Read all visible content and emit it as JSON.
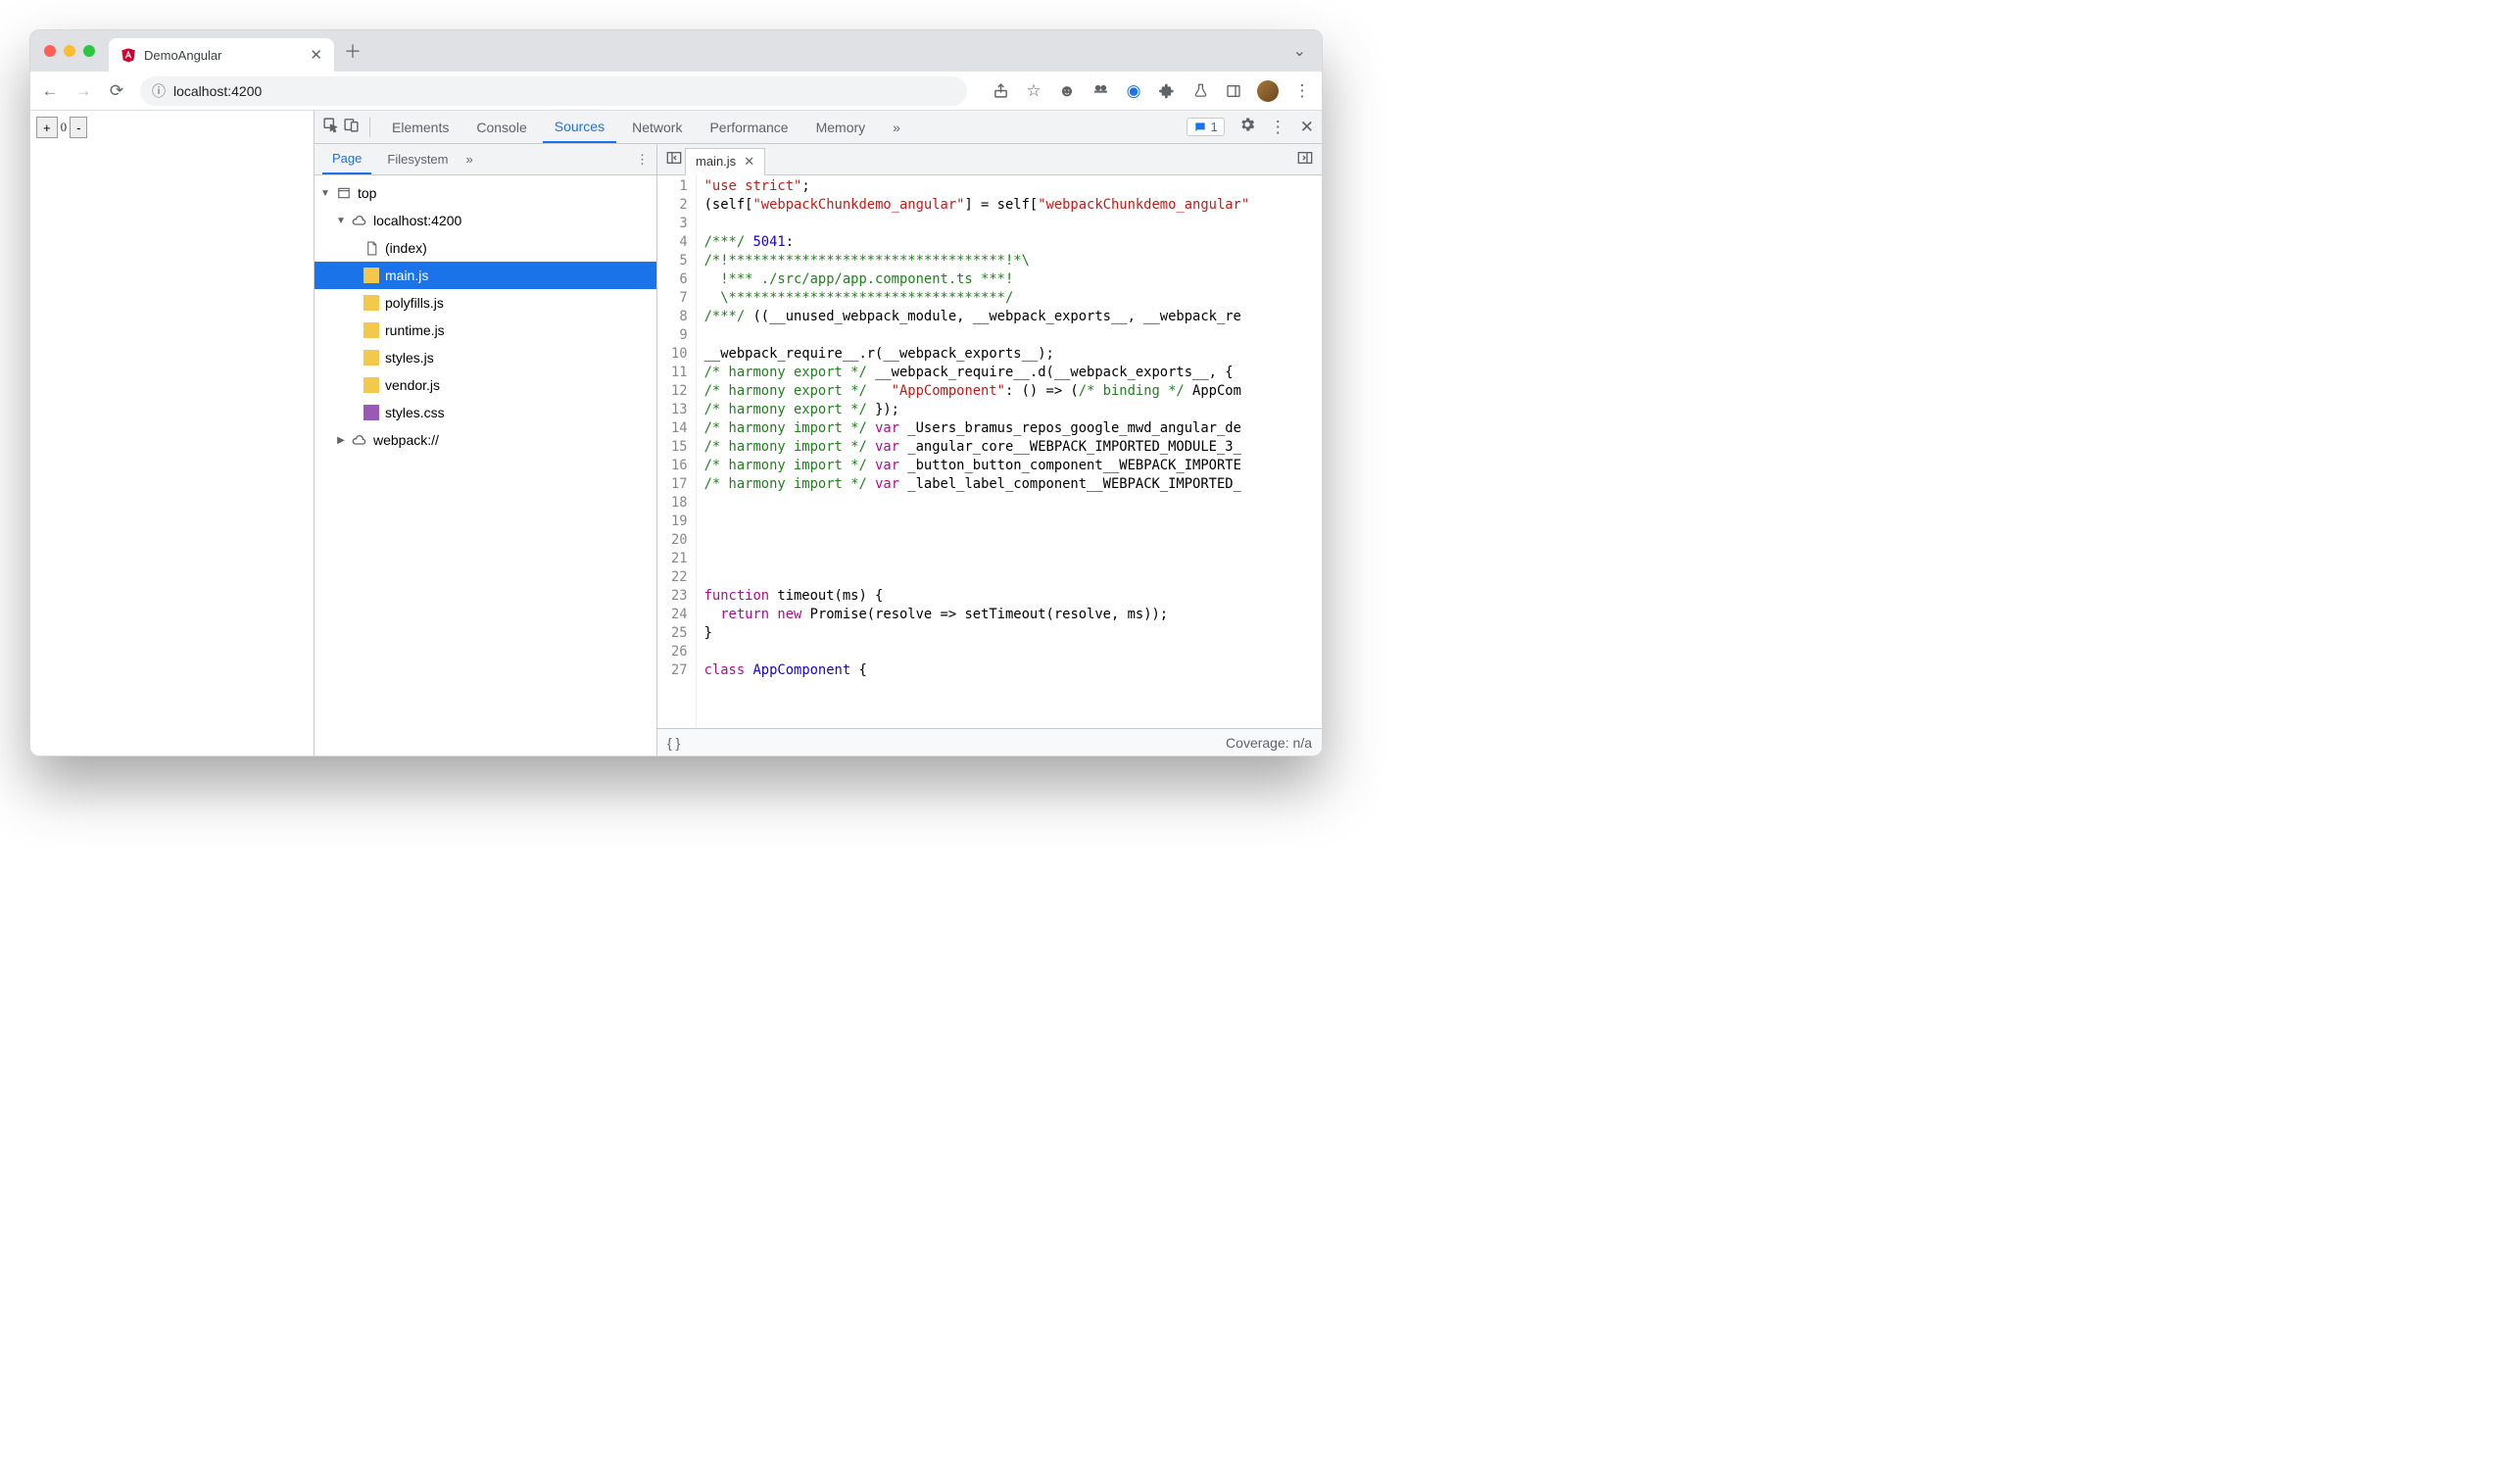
{
  "browser": {
    "tab_title": "DemoAngular",
    "address": "localhost:4200",
    "page_counter": "0"
  },
  "devtools": {
    "panels": [
      "Elements",
      "Console",
      "Sources",
      "Network",
      "Performance",
      "Memory"
    ],
    "active_panel": "Sources",
    "issues_count": "1",
    "sources": {
      "nav_tabs": [
        "Page",
        "Filesystem"
      ],
      "active_nav_tab": "Page",
      "tree": {
        "top": "top",
        "origin": "localhost:4200",
        "files": [
          "(index)",
          "main.js",
          "polyfills.js",
          "runtime.js",
          "styles.js",
          "vendor.js",
          "styles.css"
        ],
        "selected": "main.js",
        "webpack": "webpack://"
      },
      "open_file": "main.js",
      "coverage_label": "Coverage: n/a"
    },
    "code_lines": [
      {
        "n": 1,
        "seg": [
          [
            "str",
            "\"use strict\""
          ],
          [
            "",
            ";"
          ]
        ]
      },
      {
        "n": 2,
        "seg": [
          [
            "",
            "(self["
          ],
          [
            "str",
            "\"webpackChunkdemo_angular\""
          ],
          [
            "",
            "] = self["
          ],
          [
            "str",
            "\"webpackChunkdemo_angular\""
          ]
        ]
      },
      {
        "n": 3,
        "seg": [
          [
            "",
            ""
          ]
        ]
      },
      {
        "n": 4,
        "seg": [
          [
            "cmt",
            "/***/ "
          ],
          [
            "num",
            "5041"
          ],
          [
            "",
            ":"
          ]
        ]
      },
      {
        "n": 5,
        "seg": [
          [
            "cmt",
            "/*!**********************************!*\\"
          ]
        ]
      },
      {
        "n": 6,
        "seg": [
          [
            "cmt",
            "  !*** ./src/app/app.component.ts ***!"
          ]
        ]
      },
      {
        "n": 7,
        "seg": [
          [
            "cmt",
            "  \\**********************************/"
          ]
        ]
      },
      {
        "n": 8,
        "seg": [
          [
            "cmt",
            "/***/"
          ],
          [
            "",
            " ((__unused_webpack_module, __webpack_exports__, __webpack_re"
          ]
        ]
      },
      {
        "n": 9,
        "seg": [
          [
            "",
            ""
          ]
        ]
      },
      {
        "n": 10,
        "seg": [
          [
            "",
            "__webpack_require__.r(__webpack_exports__);"
          ]
        ]
      },
      {
        "n": 11,
        "seg": [
          [
            "cmt",
            "/* harmony export */"
          ],
          [
            "",
            " __webpack_require__.d(__webpack_exports__, {"
          ]
        ]
      },
      {
        "n": 12,
        "seg": [
          [
            "cmt",
            "/* harmony export */"
          ],
          [
            "",
            "   "
          ],
          [
            "str",
            "\"AppComponent\""
          ],
          [
            "",
            ": () => ("
          ],
          [
            "cmt",
            "/* binding */"
          ],
          [
            "",
            " AppCom"
          ]
        ]
      },
      {
        "n": 13,
        "seg": [
          [
            "cmt",
            "/* harmony export */"
          ],
          [
            "",
            " });"
          ]
        ]
      },
      {
        "n": 14,
        "seg": [
          [
            "cmt",
            "/* harmony import */"
          ],
          [
            "",
            " "
          ],
          [
            "kw",
            "var"
          ],
          [
            "",
            " _Users_bramus_repos_google_mwd_angular_de"
          ]
        ]
      },
      {
        "n": 15,
        "seg": [
          [
            "cmt",
            "/* harmony import */"
          ],
          [
            "",
            " "
          ],
          [
            "kw",
            "var"
          ],
          [
            "",
            " _angular_core__WEBPACK_IMPORTED_MODULE_3_"
          ]
        ]
      },
      {
        "n": 16,
        "seg": [
          [
            "cmt",
            "/* harmony import */"
          ],
          [
            "",
            " "
          ],
          [
            "kw",
            "var"
          ],
          [
            "",
            " _button_button_component__WEBPACK_IMPORTE"
          ]
        ]
      },
      {
        "n": 17,
        "seg": [
          [
            "cmt",
            "/* harmony import */"
          ],
          [
            "",
            " "
          ],
          [
            "kw",
            "var"
          ],
          [
            "",
            " _label_label_component__WEBPACK_IMPORTED_"
          ]
        ]
      },
      {
        "n": 18,
        "seg": [
          [
            "",
            ""
          ]
        ]
      },
      {
        "n": 19,
        "seg": [
          [
            "",
            ""
          ]
        ]
      },
      {
        "n": 20,
        "seg": [
          [
            "",
            ""
          ]
        ]
      },
      {
        "n": 21,
        "seg": [
          [
            "",
            ""
          ]
        ]
      },
      {
        "n": 22,
        "seg": [
          [
            "",
            ""
          ]
        ]
      },
      {
        "n": 23,
        "seg": [
          [
            "kw",
            "function"
          ],
          [
            "",
            " timeout(ms) {"
          ]
        ]
      },
      {
        "n": 24,
        "seg": [
          [
            "",
            "  "
          ],
          [
            "kw",
            "return"
          ],
          [
            "",
            " "
          ],
          [
            "kw",
            "new"
          ],
          [
            "",
            " Promise(resolve => setTimeout(resolve, ms));"
          ]
        ]
      },
      {
        "n": 25,
        "seg": [
          [
            "",
            "}"
          ]
        ]
      },
      {
        "n": 26,
        "seg": [
          [
            "",
            ""
          ]
        ]
      },
      {
        "n": 27,
        "seg": [
          [
            "kw",
            "class"
          ],
          [
            "",
            " "
          ],
          [
            "id",
            "AppComponent"
          ],
          [
            "",
            " {"
          ]
        ]
      }
    ]
  }
}
